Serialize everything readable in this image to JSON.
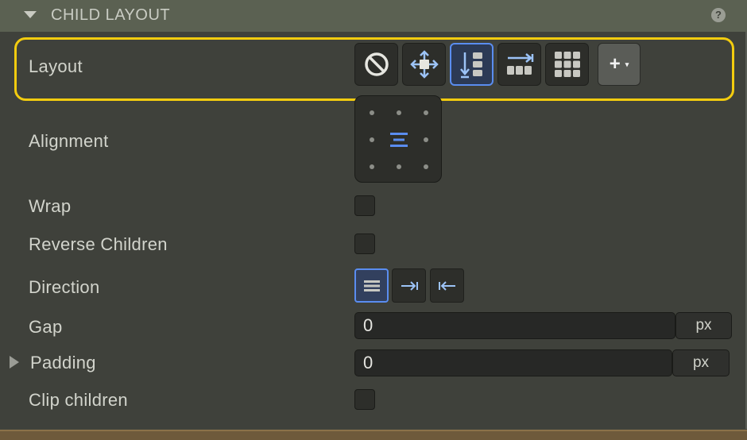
{
  "section": {
    "title": "CHILD LAYOUT",
    "help_icon": "question-circle-icon",
    "help_glyph": "?"
  },
  "layout": {
    "label": "Layout",
    "options": [
      {
        "icon": "none-icon",
        "selected": false
      },
      {
        "icon": "free-move-icon",
        "selected": false
      },
      {
        "icon": "vertical-stack-icon",
        "selected": true
      },
      {
        "icon": "horizontal-stack-icon",
        "selected": false
      },
      {
        "icon": "grid-icon",
        "selected": false
      }
    ],
    "add_glyph": "+",
    "add_caret": "▾"
  },
  "alignment": {
    "label": "Alignment",
    "selected": "center"
  },
  "wrap": {
    "label": "Wrap",
    "checked": false
  },
  "reverse_children": {
    "label": "Reverse Children",
    "checked": false
  },
  "direction": {
    "label": "Direction",
    "options": [
      {
        "icon": "stack-lines-icon",
        "selected": true
      },
      {
        "icon": "arrow-right-icon",
        "selected": false
      },
      {
        "icon": "arrow-left-icon",
        "selected": false
      }
    ]
  },
  "gap": {
    "label": "Gap",
    "value": "0",
    "unit": "px"
  },
  "padding": {
    "label": "Padding",
    "value": "0",
    "unit": "px"
  },
  "clip_children": {
    "label": "Clip children",
    "checked": false
  },
  "colors": {
    "accent": "#5a8df0",
    "highlight": "#f3cc0f",
    "header_bg": "#5b6152",
    "panel_bg": "#3f413b"
  }
}
